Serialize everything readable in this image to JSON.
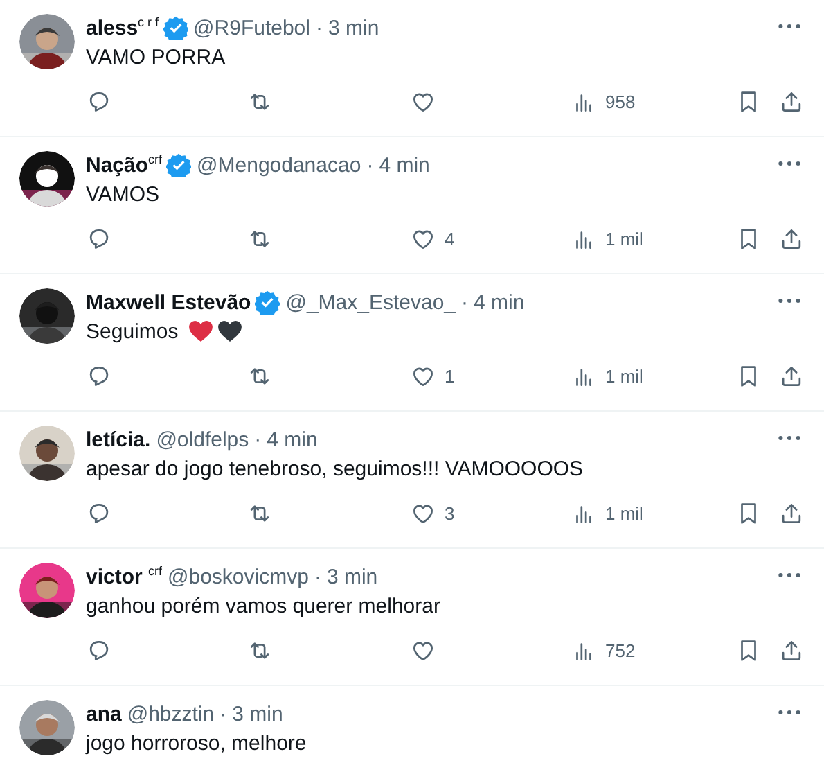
{
  "replies": [
    {
      "name": "aless$^{c r f}$",
      "verified": true,
      "handle": "@R9Futebol",
      "separator": "·",
      "time": "3 min",
      "text": "VAMO PORRA",
      "actions": {
        "views": "958"
      }
    },
    {
      "name": "Nação$^{crf}$",
      "verified": true,
      "handle": "@Mengodanacao",
      "separator": "·",
      "time": "4 min",
      "text": "VAMOS",
      "actions": {
        "likes": "4",
        "views": "1 mil"
      }
    },
    {
      "name": "Maxwell Estevão",
      "verified": true,
      "handle": "@_Max_Estevao_",
      "separator": "·",
      "time": "4 min",
      "text": "Seguimos",
      "hearts": [
        {
          "color": "#dd2e44"
        },
        {
          "color": "#31373d"
        }
      ],
      "actions": {
        "likes": "1",
        "views": "1 mil"
      }
    },
    {
      "name": "letícia.",
      "verified": false,
      "handle": "@oldfelps",
      "separator": "·",
      "time": "4 min",
      "text": "apesar do jogo tenebroso, seguimos!!! VAMOOOOOS",
      "actions": {
        "likes": "3",
        "views": "1 mil"
      }
    },
    {
      "name": "victor $^{crf}$",
      "verified": false,
      "handle": "@boskovicmvp",
      "separator": "·",
      "time": "3 min",
      "text": "ganhou porém vamos querer melhorar",
      "actions": {
        "views": "752"
      }
    },
    {
      "name": "ana",
      "verified": false,
      "handle": "@hbzztin",
      "separator": "·",
      "time": "3 min",
      "text": "jogo horroroso, melhore"
    }
  ]
}
